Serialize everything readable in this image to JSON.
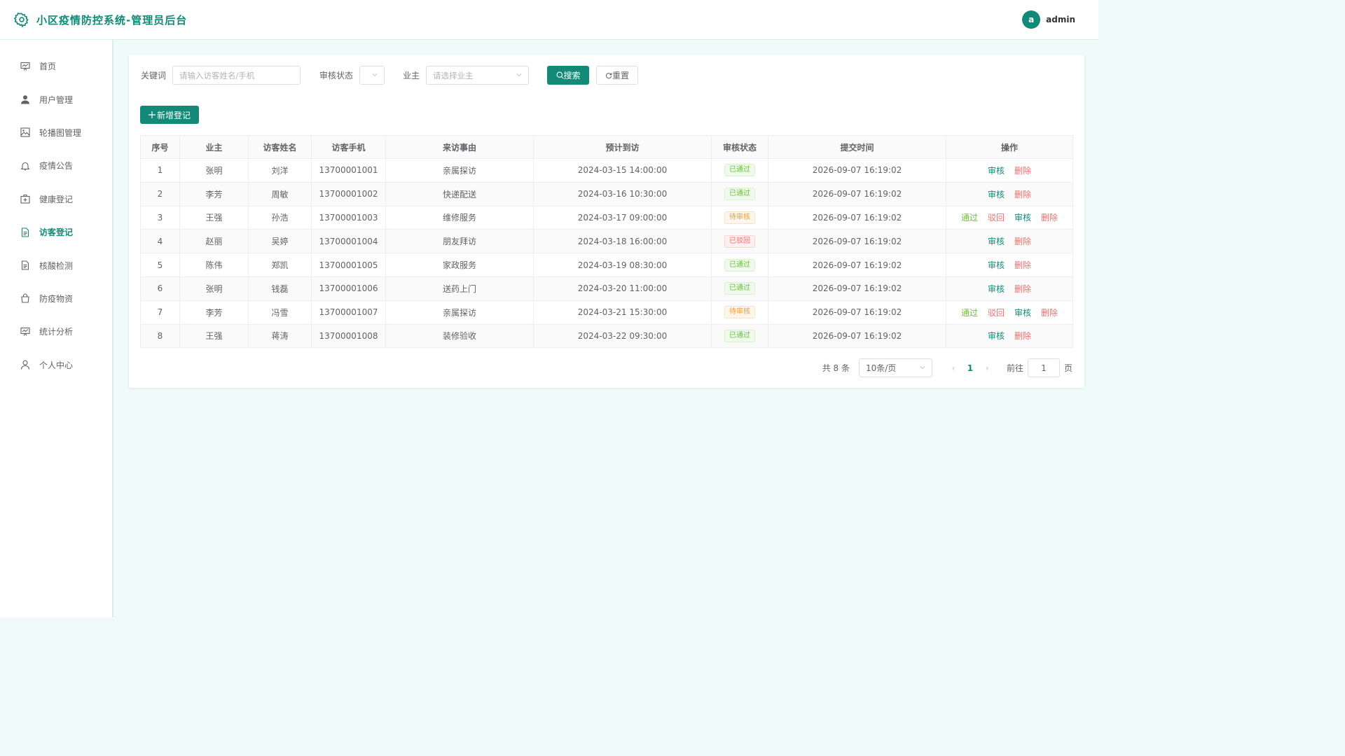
{
  "header": {
    "title": "小区疫情防控系统-管理员后台",
    "avatar_letter": "a",
    "username": "admin"
  },
  "colors": {
    "primary": "#138a78",
    "pass": "#67c23a",
    "pending": "#e6a23c",
    "reject": "#f56c6c"
  },
  "sidebar": {
    "items": [
      {
        "label": "首页",
        "icon": "chart-board-icon"
      },
      {
        "label": "用户管理",
        "icon": "user-icon"
      },
      {
        "label": "轮播图管理",
        "icon": "image-icon"
      },
      {
        "label": "疫情公告",
        "icon": "bell-icon"
      },
      {
        "label": "健康登记",
        "icon": "medical-kit-icon"
      },
      {
        "label": "访客登记",
        "icon": "document-icon",
        "active": true
      },
      {
        "label": "核酸检测",
        "icon": "document-icon"
      },
      {
        "label": "防疫物资",
        "icon": "bag-icon"
      },
      {
        "label": "统计分析",
        "icon": "chart-board-icon"
      },
      {
        "label": "个人中心",
        "icon": "person-icon"
      }
    ]
  },
  "filters": {
    "keyword_label": "关键词",
    "keyword_placeholder": "请输入访客姓名/手机",
    "status_label": "审核状态",
    "owner_label": "业主",
    "owner_placeholder": "请选择业主",
    "search_label": "搜索",
    "reset_label": "重置"
  },
  "add_button": "新增登记",
  "table": {
    "columns": [
      "序号",
      "业主",
      "访客姓名",
      "访客手机",
      "来访事由",
      "预计到访",
      "审核状态",
      "提交时间",
      "操作"
    ],
    "rows": [
      {
        "no": "1",
        "owner": "张明",
        "visitor": "刘洋",
        "phone": "13700001001",
        "reason": "亲属探访",
        "expected": "2024-03-15 14:00:00",
        "status": "已通过",
        "status_type": "pass",
        "submitted": "2026-09-07 16:19:02",
        "ops": [
          "审核",
          "删除"
        ]
      },
      {
        "no": "2",
        "owner": "李芳",
        "visitor": "周敏",
        "phone": "13700001002",
        "reason": "快递配送",
        "expected": "2024-03-16 10:30:00",
        "status": "已通过",
        "status_type": "pass",
        "submitted": "2026-09-07 16:19:02",
        "ops": [
          "审核",
          "删除"
        ]
      },
      {
        "no": "3",
        "owner": "王强",
        "visitor": "孙浩",
        "phone": "13700001003",
        "reason": "维修服务",
        "expected": "2024-03-17 09:00:00",
        "status": "待审核",
        "status_type": "pending",
        "submitted": "2026-09-07 16:19:02",
        "ops": [
          "通过",
          "驳回",
          "审核",
          "删除"
        ]
      },
      {
        "no": "4",
        "owner": "赵丽",
        "visitor": "吴婷",
        "phone": "13700001004",
        "reason": "朋友拜访",
        "expected": "2024-03-18 16:00:00",
        "status": "已驳回",
        "status_type": "reject",
        "submitted": "2026-09-07 16:19:02",
        "ops": [
          "审核",
          "删除"
        ]
      },
      {
        "no": "5",
        "owner": "陈伟",
        "visitor": "郑凯",
        "phone": "13700001005",
        "reason": "家政服务",
        "expected": "2024-03-19 08:30:00",
        "status": "已通过",
        "status_type": "pass",
        "submitted": "2026-09-07 16:19:02",
        "ops": [
          "审核",
          "删除"
        ]
      },
      {
        "no": "6",
        "owner": "张明",
        "visitor": "钱磊",
        "phone": "13700001006",
        "reason": "送药上门",
        "expected": "2024-03-20 11:00:00",
        "status": "已通过",
        "status_type": "pass",
        "submitted": "2026-09-07 16:19:02",
        "ops": [
          "审核",
          "删除"
        ]
      },
      {
        "no": "7",
        "owner": "李芳",
        "visitor": "冯雪",
        "phone": "13700001007",
        "reason": "亲属探访",
        "expected": "2024-03-21 15:30:00",
        "status": "待审核",
        "status_type": "pending",
        "submitted": "2026-09-07 16:19:02",
        "ops": [
          "通过",
          "驳回",
          "审核",
          "删除"
        ]
      },
      {
        "no": "8",
        "owner": "王强",
        "visitor": "蒋涛",
        "phone": "13700001008",
        "reason": "装修验收",
        "expected": "2024-03-22 09:30:00",
        "status": "已通过",
        "status_type": "pass",
        "submitted": "2026-09-07 16:19:02",
        "ops": [
          "审核",
          "删除"
        ]
      }
    ]
  },
  "pagination": {
    "total_text": "共 8 条",
    "page_size": "10条/页",
    "current": "1",
    "goto_label": "前往",
    "goto_value": "1",
    "page_suffix": "页"
  }
}
